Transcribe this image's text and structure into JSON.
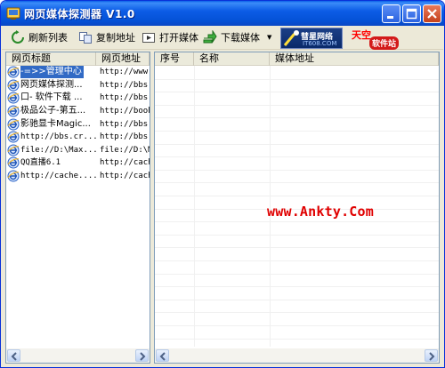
{
  "window": {
    "title": "网页媒体探测器 V1.0"
  },
  "toolbar": {
    "refresh_label": "刷新列表",
    "copy_label": "复制地址",
    "open_label": "打开媒体",
    "download_label": "下载媒体",
    "logo_comet_line1": "彗星网络",
    "logo_comet_line2": "IT608.COM",
    "logo_kuangtian_line1": "天空",
    "logo_kuangtian_line2": "软件站"
  },
  "left_list": {
    "columns": [
      "网页标题",
      "网页地址"
    ],
    "rows": [
      {
        "title": "-=>>管理中心",
        "url": "http://www.",
        "selected": true
      },
      {
        "title": "网页媒体探测...",
        "url": "http://bbs."
      },
      {
        "title": "口- 软件下载 ...",
        "url": "http://bbs."
      },
      {
        "title": "极品公子-第五...",
        "url": "http://book"
      },
      {
        "title": "影驰显卡Magic...",
        "url": "http://bbs."
      },
      {
        "title": "http://bbs.cr...",
        "url": "http://bbs."
      },
      {
        "title": "file://D:\\Max...",
        "url": "file://D:\\M"
      },
      {
        "title": "QQ直播6.1",
        "url": "http://cach"
      },
      {
        "title": "http://cache....",
        "url": "http://cach"
      }
    ]
  },
  "right_list": {
    "columns": [
      "序号",
      "名称",
      "媒体地址"
    ]
  },
  "watermark": "www.Ankty.Com",
  "colors": {
    "titlebar": "#0451d6",
    "selection": "#316ac5",
    "watermark": "#e00000"
  }
}
